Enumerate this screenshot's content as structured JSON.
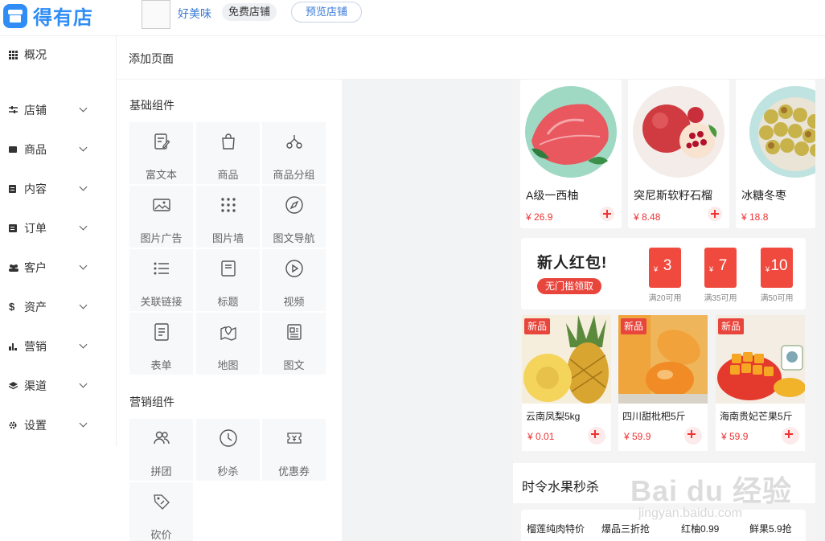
{
  "header": {
    "logo_text": "得有店",
    "shop_name": "好美味",
    "free_tag": "免费店铺",
    "preview_label": "预览店铺"
  },
  "sidebar": {
    "items": [
      {
        "label": "概况",
        "icon": "grid-icon"
      },
      {
        "label": "店铺",
        "icon": "sliders-icon"
      },
      {
        "label": "商品",
        "icon": "box-icon"
      },
      {
        "label": "内容",
        "icon": "document-icon"
      },
      {
        "label": "订单",
        "icon": "list-icon"
      },
      {
        "label": "客户",
        "icon": "users-icon"
      },
      {
        "label": "资产",
        "icon": "dollar-icon"
      },
      {
        "label": "营销",
        "icon": "bar-chart-icon"
      },
      {
        "label": "渠道",
        "icon": "layers-icon"
      },
      {
        "label": "设置",
        "icon": "gear-icon"
      }
    ]
  },
  "page_title": "添加页面",
  "components": {
    "basic_title": "基础组件",
    "basic": [
      {
        "label": "富文本",
        "icon": "rich-text-icon"
      },
      {
        "label": "商品",
        "icon": "shopping-bag-icon"
      },
      {
        "label": "商品分组",
        "icon": "product-group-icon"
      },
      {
        "label": "图片广告",
        "icon": "image-icon"
      },
      {
        "label": "图片墙",
        "icon": "dots-grid-icon"
      },
      {
        "label": "图文导航",
        "icon": "compass-icon"
      },
      {
        "label": "关联链接",
        "icon": "list-link-icon"
      },
      {
        "label": "标题",
        "icon": "title-icon"
      },
      {
        "label": "视频",
        "icon": "play-icon"
      },
      {
        "label": "表单",
        "icon": "form-icon"
      },
      {
        "label": "地图",
        "icon": "map-icon"
      },
      {
        "label": "图文",
        "icon": "article-icon"
      }
    ],
    "marketing_title": "营销组件",
    "marketing": [
      {
        "label": "拼团",
        "icon": "group-buy-icon"
      },
      {
        "label": "秒杀",
        "icon": "clock-icon"
      },
      {
        "label": "优惠券",
        "icon": "coupon-icon"
      },
      {
        "label": "砍价",
        "icon": "price-tag-icon"
      }
    ]
  },
  "preview": {
    "products": [
      {
        "name": "A级一西柚",
        "price": "¥ 26.9"
      },
      {
        "name": "突尼斯软籽石榴",
        "price": "¥ 8.48"
      },
      {
        "name": "冰糖冬枣",
        "price": "¥ 18.8"
      }
    ],
    "red_packet": {
      "title": "新人红包!",
      "button": "无门槛领取",
      "coupons": [
        {
          "yen": "¥",
          "amount": "3",
          "caption": "满20可用"
        },
        {
          "yen": "¥",
          "amount": "7",
          "caption": "满35可用"
        },
        {
          "yen": "¥",
          "amount": "10",
          "caption": "满50可用"
        }
      ]
    },
    "fruits": [
      {
        "tag": "新品",
        "name": "云南凤梨5kg",
        "price": "¥ 0.01"
      },
      {
        "tag": "新品",
        "name": "四川甜枇杷5斤",
        "price": "¥ 59.9"
      },
      {
        "tag": "新品",
        "name": "海南贵妃芒果5斤",
        "price": "¥ 59.9"
      }
    ],
    "flash_title": "时令水果秒杀",
    "tabs": [
      "榴莲纯肉特价",
      "爆品三折抢",
      "红柚0.99",
      "鲜果5.9抢"
    ]
  },
  "watermark": {
    "text": "Bai du 经验",
    "sub": "jingyan.baidu.com"
  },
  "colors": {
    "brand_blue": "#2f8df5",
    "price_red": "#e33333",
    "coupon_red": "#f04a3f"
  }
}
